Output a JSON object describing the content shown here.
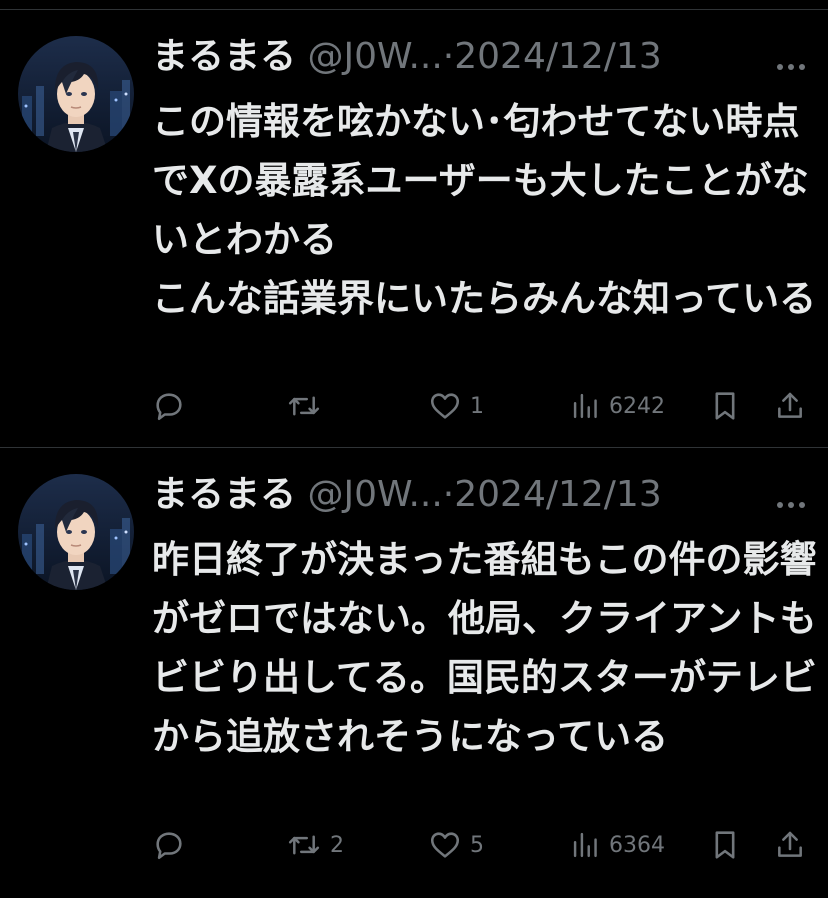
{
  "tweets": [
    {
      "display_name": "まるまる",
      "handle": "@J0W...",
      "separator": "·",
      "date": "2024/12/13",
      "text": "この情報を呟かない･匂わせてない時点でXの暴露系ユーザーも大したことがないとわかる\nこんな話業界にいたらみんな知っている",
      "reply_count": "",
      "retweet_count": "",
      "like_count": "1",
      "view_count": "6242"
    },
    {
      "display_name": "まるまる",
      "handle": "@J0W...",
      "separator": "·",
      "date": "2024/12/13",
      "text": "昨日終了が決まった番組もこの件の影響がゼロではない。他局、クライアントもビビり出してる。国民的スターがテレビから追放されそうになっている",
      "reply_count": "",
      "retweet_count": "2",
      "like_count": "5",
      "view_count": "6364"
    }
  ],
  "icons": {
    "more": "more-dots-icon",
    "reply": "reply-bubble-icon",
    "retweet": "retweet-icon",
    "like": "heart-icon",
    "views": "views-bar-chart-icon",
    "bookmark": "bookmark-icon",
    "share": "share-icon"
  },
  "colors": {
    "background": "#000000",
    "text_primary": "#e7e9ea",
    "text_secondary": "#71767b",
    "divider": "#2f3336"
  }
}
